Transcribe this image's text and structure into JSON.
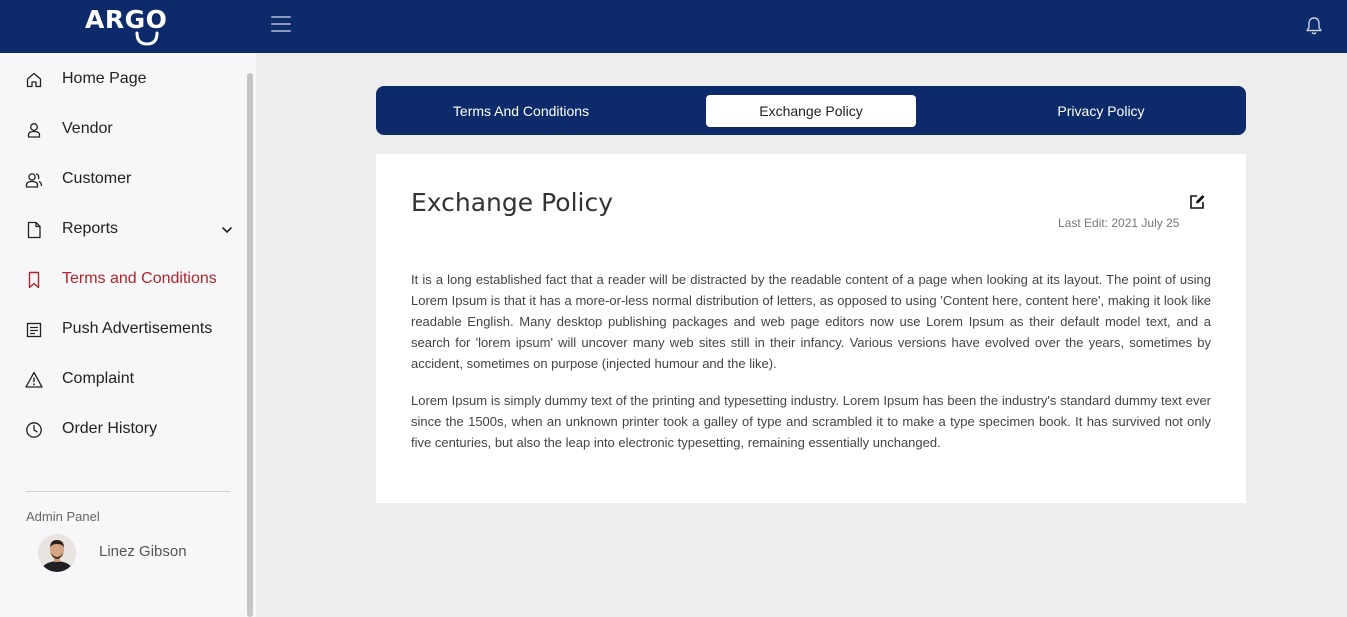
{
  "header": {
    "logo_text": "ARGO",
    "menu_icon": "hamburger-icon",
    "notification_icon": "bell-icon",
    "brand_color": "#0d2a6a"
  },
  "sidebar": {
    "items": [
      {
        "label": "Home Page",
        "icon": "home-icon"
      },
      {
        "label": "Vendor",
        "icon": "user-icon"
      },
      {
        "label": "Customer",
        "icon": "users-icon"
      },
      {
        "label": "Reports",
        "icon": "file-icon"
      },
      {
        "label": "Terms and Conditions",
        "icon": "bookmark-icon",
        "active": true
      },
      {
        "label": "Push Advertisements",
        "icon": "list-icon"
      },
      {
        "label": "Complaint",
        "icon": "warning-icon"
      },
      {
        "label": "Order History",
        "icon": "clock-icon"
      }
    ],
    "active_color": "#b0262c",
    "admin_label": "Admin Panel",
    "admin_name": "Linez Gibson"
  },
  "tabs": [
    {
      "label": "Terms And Conditions"
    },
    {
      "label": "Exchange Policy",
      "active": true
    },
    {
      "label": "Privacy Policy"
    }
  ],
  "content": {
    "title": "Exchange Policy",
    "last_edit": "Last Edit: 2021 July 25",
    "paragraphs": [
      "It is a long established fact that a reader will be distracted by the readable content of a page when looking at its layout. The point of using Lorem Ipsum is that it has a more-or-less normal distribution of letters, as opposed to using 'Content here, content here', making it look like readable English. Many desktop publishing packages and web page editors now use Lorem Ipsum as their default model text, and a search for 'lorem ipsum' will uncover many web sites still in their infancy. Various versions have evolved over the years, sometimes by accident, sometimes on purpose (injected humour and the like).",
      "Lorem Ipsum is simply dummy text of the printing and typesetting industry. Lorem Ipsum has been the industry's standard dummy text ever since the 1500s, when an unknown printer took a galley of type and scrambled it to make a type specimen book. It has survived not only five centuries, but also the leap into electronic typesetting, remaining essentially unchanged."
    ]
  }
}
